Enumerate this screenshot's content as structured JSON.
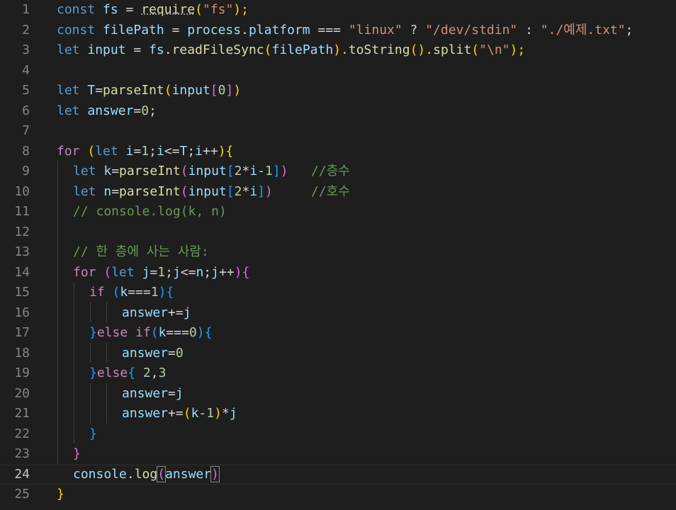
{
  "editor": {
    "line_numbers": [
      "1",
      "2",
      "3",
      "4",
      "5",
      "6",
      "7",
      "8",
      "9",
      "10",
      "11",
      "12",
      "13",
      "14",
      "15",
      "16",
      "17",
      "18",
      "19",
      "20",
      "21",
      "22",
      "23",
      "24",
      "25"
    ],
    "active_line": "24"
  },
  "code": {
    "l1": [
      "const",
      " ",
      "fs",
      " = ",
      "require",
      "(",
      "\"fs\"",
      ");"
    ],
    "l2": [
      "const",
      " ",
      "filePath",
      " = ",
      "process",
      ".",
      "platform",
      " === ",
      "\"linux\"",
      " ? ",
      "\"/dev/stdin\"",
      " : ",
      "\"./예제.txt\"",
      ";"
    ],
    "l3": [
      "let",
      " ",
      "input",
      " = ",
      "fs",
      ".",
      "readFileSync",
      "(",
      "filePath",
      ").",
      "toString",
      "(",
      ").",
      "split",
      "(",
      "\"\\n\"",
      ");"
    ],
    "l5": [
      "let",
      " ",
      "T",
      "=",
      "parseInt",
      "(",
      "input",
      "[",
      "0",
      "]",
      ")"
    ],
    "l6": [
      "let",
      " ",
      "answer",
      "=",
      "0",
      ";"
    ],
    "l8": [
      "for",
      " ",
      "(",
      "let",
      " ",
      "i",
      "=",
      "1",
      ";",
      "i",
      "<=",
      "T",
      ";",
      "i",
      "++",
      ")",
      "{"
    ],
    "l9": [
      "let",
      " ",
      "k",
      "=",
      "parseInt",
      "(",
      "input",
      "[",
      "2",
      "*",
      "i",
      "-",
      "1",
      "]",
      ")",
      "   ",
      "//층수"
    ],
    "l10": [
      "let",
      " ",
      "n",
      "=",
      "parseInt",
      "(",
      "input",
      "[",
      "2",
      "*",
      "i",
      "]",
      ")",
      "     ",
      "//호수"
    ],
    "l11": [
      "// console.log(k, n)"
    ],
    "l13": [
      "// 한 층에 사는 사람:"
    ],
    "l14": [
      "for",
      " ",
      "(",
      "let",
      " ",
      "j",
      "=",
      "1",
      ";",
      "j",
      "<=",
      "n",
      ";",
      "j",
      "++",
      ")",
      "{"
    ],
    "l15": [
      "if",
      " ",
      "(",
      "k",
      "===",
      "1",
      ")",
      "{"
    ],
    "l16": [
      "answer",
      "+=",
      "j"
    ],
    "l17": [
      "}",
      "else",
      " ",
      "if",
      "(",
      "k",
      "===",
      "0",
      ")",
      "{"
    ],
    "l18": [
      "answer",
      "=",
      "0"
    ],
    "l19": [
      "}",
      "else",
      "{",
      " ",
      "2",
      ",",
      "3"
    ],
    "l20": [
      "answer",
      "=",
      "j"
    ],
    "l21": [
      "answer",
      "+=",
      "(",
      "k",
      "-",
      "1",
      ")",
      "*",
      "j"
    ],
    "l22": [
      "}"
    ],
    "l23": [
      "}"
    ],
    "l24": [
      "console",
      ".",
      "log",
      "(",
      "answer",
      ")"
    ],
    "l25": [
      "}"
    ]
  }
}
